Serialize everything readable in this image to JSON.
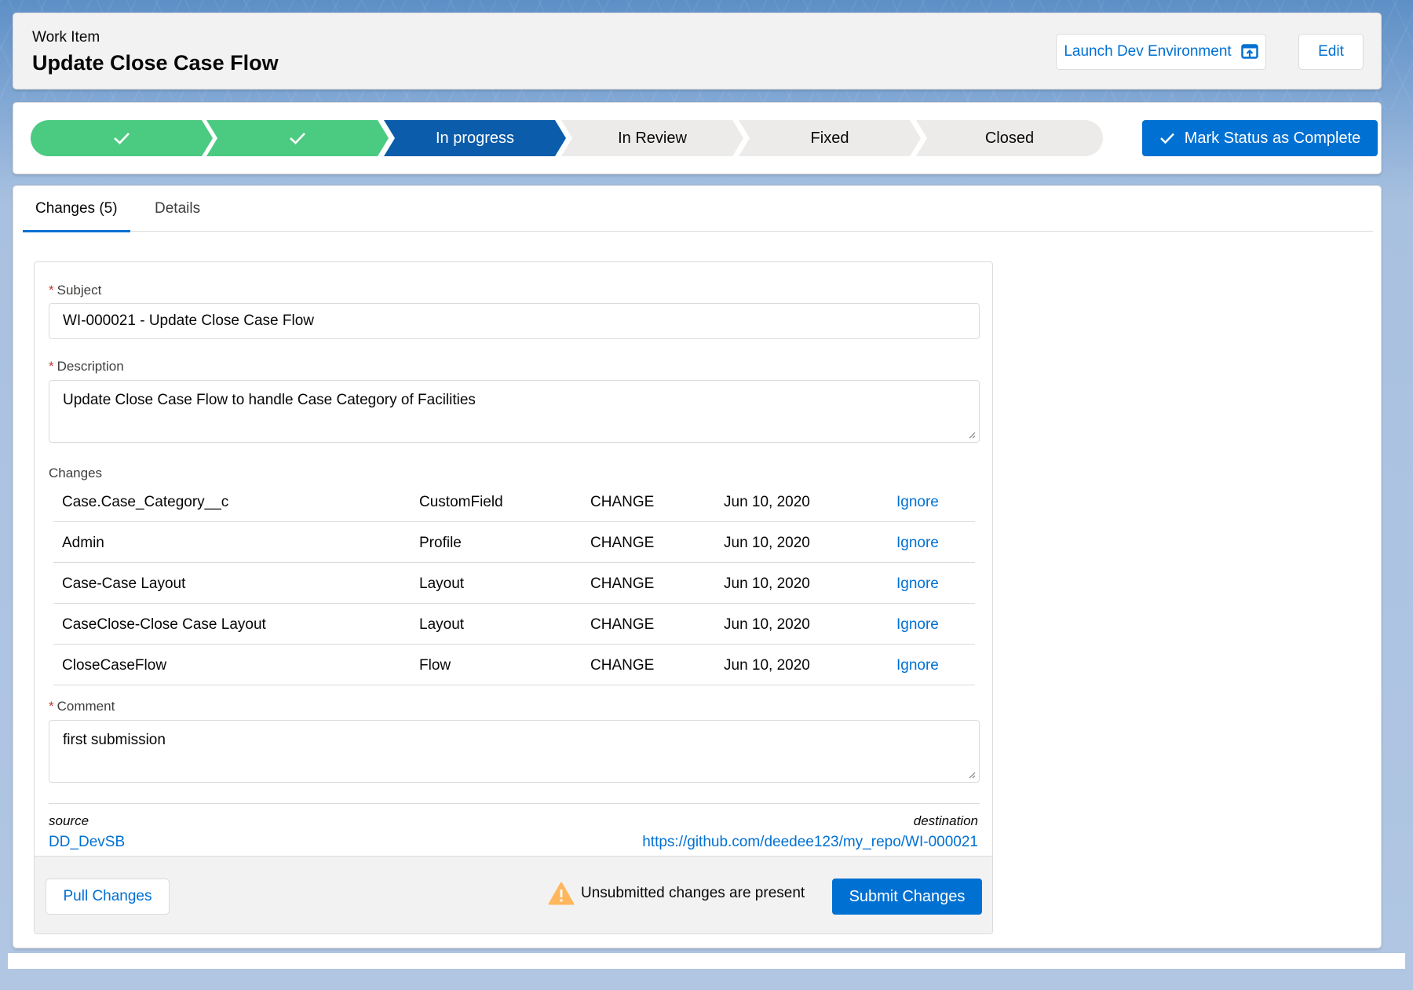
{
  "header": {
    "eyebrow": "Work Item",
    "title": "Update Close Case Flow",
    "launch_label": "Launch Dev Environment",
    "edit_label": "Edit"
  },
  "path": {
    "steps": [
      {
        "label": "",
        "state": "complete"
      },
      {
        "label": "",
        "state": "complete"
      },
      {
        "label": "In progress",
        "state": "current"
      },
      {
        "label": "In Review",
        "state": "incomplete"
      },
      {
        "label": "Fixed",
        "state": "incomplete"
      },
      {
        "label": "Closed",
        "state": "incomplete"
      }
    ],
    "mark_label": "Mark Status as Complete"
  },
  "tabs": [
    {
      "label": "Changes (5)",
      "active": true
    },
    {
      "label": "Details",
      "active": false
    }
  ],
  "form": {
    "subject_label": "Subject",
    "subject_value": "WI-000021 - Update Close Case Flow",
    "description_label": "Description",
    "description_value": "Update Close Case Flow to handle Case Category of Facilities",
    "changes_label": "Changes",
    "changes": [
      {
        "name": "Case.Case_Category__c",
        "type": "CustomField",
        "operation": "CHANGE",
        "date": "Jun 10, 2020",
        "action": "Ignore"
      },
      {
        "name": "Admin",
        "type": "Profile",
        "operation": "CHANGE",
        "date": "Jun 10, 2020",
        "action": "Ignore"
      },
      {
        "name": "Case-Case Layout",
        "type": "Layout",
        "operation": "CHANGE",
        "date": "Jun 10, 2020",
        "action": "Ignore"
      },
      {
        "name": "CaseClose-Close Case Layout",
        "type": "Layout",
        "operation": "CHANGE",
        "date": "Jun 10, 2020",
        "action": "Ignore"
      },
      {
        "name": "CloseCaseFlow",
        "type": "Flow",
        "operation": "CHANGE",
        "date": "Jun 10, 2020",
        "action": "Ignore"
      }
    ],
    "comment_label": "Comment",
    "comment_value": "first submission",
    "required_marker": "*"
  },
  "source_dest": {
    "source_label": "source",
    "source_value": "DD_DevSB",
    "destination_label": "destination",
    "destination_value": "https://github.com/deedee123/my_repo/WI-000021"
  },
  "footer": {
    "pull_label": "Pull Changes",
    "warning_text": "Unsubmitted changes are present",
    "submit_label": "Submit Changes"
  },
  "colors": {
    "brand": "#0070d2",
    "path_complete": "#4bca81",
    "path_current": "#0b5cab",
    "path_incomplete": "#ecebea",
    "warning": "#ffb75d"
  }
}
